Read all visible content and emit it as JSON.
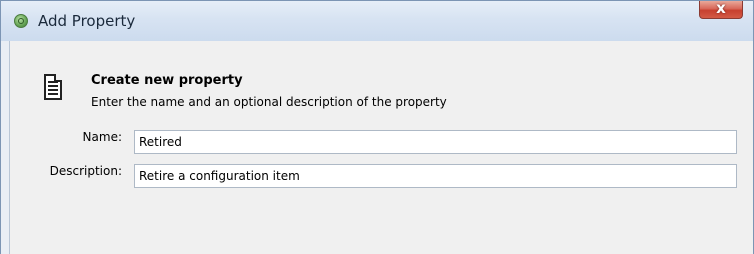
{
  "window": {
    "title": "Add Property",
    "close_label": "x"
  },
  "header": {
    "title": "Create new property",
    "description": "Enter the name and an optional description of the property",
    "icon": "document-icon"
  },
  "form": {
    "name": {
      "label": "Name:",
      "value": "Retired"
    },
    "description": {
      "label": "Description:",
      "value": "Retire a configuration item"
    }
  },
  "colors": {
    "titlebar": "#d7e3f2",
    "client_bg": "#f0f0f0",
    "close_button": "#c7402f"
  }
}
